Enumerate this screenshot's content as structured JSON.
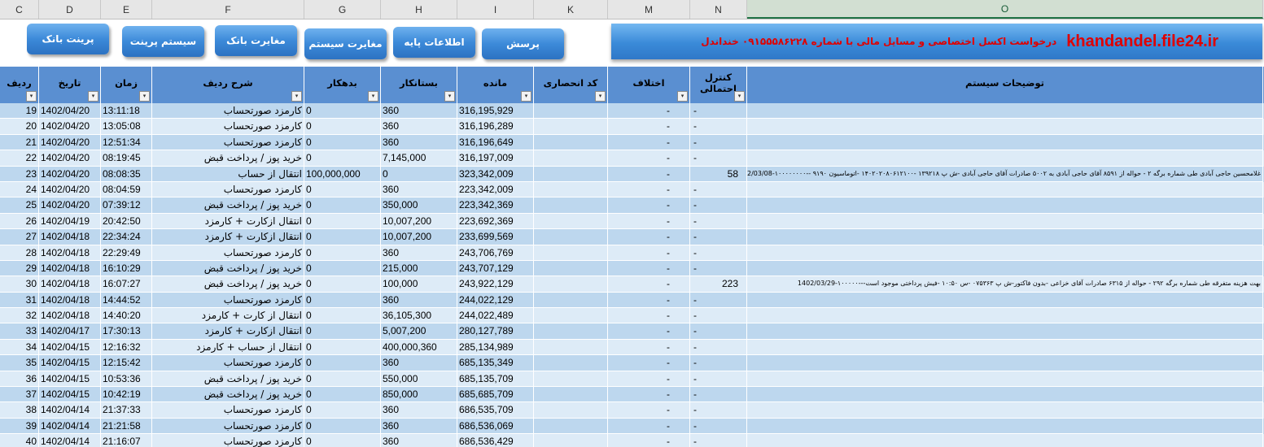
{
  "column_letters": [
    "C",
    "D",
    "E",
    "F",
    "G",
    "H",
    "I",
    "K",
    "M",
    "N",
    "O"
  ],
  "buttons": {
    "print_bank": "پرینت بانک",
    "system_print": "سیستم پرینت",
    "bank_mismatch": "مغایرت بانک",
    "system_mismatch": "مغایرت سیستم",
    "base_info": "اطلاعات پایه",
    "question": "پرسش"
  },
  "banner": {
    "site": "khandandel.file24.ir",
    "request": "درخواست اکسل اختصاصی و مسایل مالی با شماره ۰۹۱۵۵۵۸۶۲۲۸ خنداندل"
  },
  "headers": {
    "row_no": "ردیف",
    "date": "تاریخ",
    "time": "زمان",
    "row_desc": "شرح ردیف",
    "debit": "بدهکار",
    "credit": "بستانکار",
    "balance": "مانده",
    "exclusive_code": "کد انحصاری",
    "difference": "اختلاف",
    "probable_control_1": "کنترل",
    "probable_control_2": "احتمالی",
    "system_notes": "توضیحات سیستم"
  },
  "dropdown_glyph": "▾",
  "rows": [
    {
      "no": "19",
      "date": "1402/04/20",
      "time": "13:11:18",
      "desc": "کارمزد صورتحساب",
      "debit": "0",
      "credit": "360",
      "balance": "316,195,929",
      "code": "",
      "diff": "-",
      "ctrl": "-",
      "notes": ""
    },
    {
      "no": "20",
      "date": "1402/04/20",
      "time": "13:05:08",
      "desc": "کارمزد صورتحساب",
      "debit": "0",
      "credit": "360",
      "balance": "316,196,289",
      "code": "",
      "diff": "-",
      "ctrl": "-",
      "notes": ""
    },
    {
      "no": "21",
      "date": "1402/04/20",
      "time": "12:51:34",
      "desc": "کارمزد صورتحساب",
      "debit": "0",
      "credit": "360",
      "balance": "316,196,649",
      "code": "",
      "diff": "-",
      "ctrl": "-",
      "notes": ""
    },
    {
      "no": "22",
      "date": "1402/04/20",
      "time": "08:19:45",
      "desc": "خرید پوز / پرداخت قبض",
      "debit": "0",
      "credit": "7,145,000",
      "balance": "316,197,009",
      "code": "",
      "diff": "-",
      "ctrl": "-",
      "notes": ""
    },
    {
      "no": "23",
      "date": "1402/04/20",
      "time": "08:08:35",
      "desc": "انتقال از حساب",
      "debit": "100,000,000",
      "credit": "0",
      "balance": "323,342,009",
      "code": "",
      "diff": "-",
      "ctrl": "58",
      "notes": "غلامحسین حاجی آبادی طی شماره برگه ۲ - حواله از ۸۵۹۱ آقای حاجی آبادی به ۵۰۰۲ صادرات آقای حاجی آبادی -ش پ ۱۳۹۲۱۸ -۱۴۰۲۰۲۰۸۰۶۱۲۱۰۰ -اتوماسیون ۹۱۹۰ --۱۰۰۰۰۰۰۰۰-1402/03/08"
    },
    {
      "no": "24",
      "date": "1402/04/20",
      "time": "08:04:59",
      "desc": "کارمزد صورتحساب",
      "debit": "0",
      "credit": "360",
      "balance": "223,342,009",
      "code": "",
      "diff": "-",
      "ctrl": "-",
      "notes": ""
    },
    {
      "no": "25",
      "date": "1402/04/20",
      "time": "07:39:12",
      "desc": "خرید پوز / پرداخت قبض",
      "debit": "0",
      "credit": "350,000",
      "balance": "223,342,369",
      "code": "",
      "diff": "-",
      "ctrl": "-",
      "notes": ""
    },
    {
      "no": "26",
      "date": "1402/04/19",
      "time": "20:42:50",
      "desc": "انتقال ازکارت + کارمزد",
      "debit": "0",
      "credit": "10,007,200",
      "balance": "223,692,369",
      "code": "",
      "diff": "-",
      "ctrl": "-",
      "notes": ""
    },
    {
      "no": "27",
      "date": "1402/04/18",
      "time": "22:34:24",
      "desc": "انتقال ازکارت + کارمزد",
      "debit": "0",
      "credit": "10,007,200",
      "balance": "233,699,569",
      "code": "",
      "diff": "-",
      "ctrl": "-",
      "notes": ""
    },
    {
      "no": "28",
      "date": "1402/04/18",
      "time": "22:29:49",
      "desc": "کارمزد صورتحساب",
      "debit": "0",
      "credit": "360",
      "balance": "243,706,769",
      "code": "",
      "diff": "-",
      "ctrl": "-",
      "notes": ""
    },
    {
      "no": "29",
      "date": "1402/04/18",
      "time": "16:10:29",
      "desc": "خرید پوز / پرداخت قبض",
      "debit": "0",
      "credit": "215,000",
      "balance": "243,707,129",
      "code": "",
      "diff": "-",
      "ctrl": "-",
      "notes": ""
    },
    {
      "no": "30",
      "date": "1402/04/18",
      "time": "16:07:27",
      "desc": "خرید پوز / پرداخت قبض",
      "debit": "0",
      "credit": "100,000",
      "balance": "243,922,129",
      "code": "",
      "diff": "-",
      "ctrl": "223",
      "notes": "بهت هزینه متفرقه طی شماره برگه ۲۹۲ - حواله از ۶۳۱۵ صادرات آقای خزاعی -بدون فاکتور-ش پ ۰۷۵۳۶۳ -س ۱۰:۵۰ -فیش پرداختی موجود است---۱۰۰۰۰۰-1402/03/29"
    },
    {
      "no": "31",
      "date": "1402/04/18",
      "time": "14:44:52",
      "desc": "کارمزد صورتحساب",
      "debit": "0",
      "credit": "360",
      "balance": "244,022,129",
      "code": "",
      "diff": "-",
      "ctrl": "-",
      "notes": ""
    },
    {
      "no": "32",
      "date": "1402/04/18",
      "time": "14:40:20",
      "desc": "انتقال از کارت + کارمزد",
      "debit": "0",
      "credit": "36,105,300",
      "balance": "244,022,489",
      "code": "",
      "diff": "-",
      "ctrl": "-",
      "notes": ""
    },
    {
      "no": "33",
      "date": "1402/04/17",
      "time": "17:30:13",
      "desc": "انتقال ازکارت + کارمزد",
      "debit": "0",
      "credit": "5,007,200",
      "balance": "280,127,789",
      "code": "",
      "diff": "-",
      "ctrl": "-",
      "notes": ""
    },
    {
      "no": "34",
      "date": "1402/04/15",
      "time": "12:16:32",
      "desc": "انتقال از حساب + کارمزد",
      "debit": "0",
      "credit": "400,000,360",
      "balance": "285,134,989",
      "code": "",
      "diff": "-",
      "ctrl": "-",
      "notes": ""
    },
    {
      "no": "35",
      "date": "1402/04/15",
      "time": "12:15:42",
      "desc": "کارمزد صورتحساب",
      "debit": "0",
      "credit": "360",
      "balance": "685,135,349",
      "code": "",
      "diff": "-",
      "ctrl": "-",
      "notes": ""
    },
    {
      "no": "36",
      "date": "1402/04/15",
      "time": "10:53:36",
      "desc": "خرید پوز / پرداخت قبض",
      "debit": "0",
      "credit": "550,000",
      "balance": "685,135,709",
      "code": "",
      "diff": "-",
      "ctrl": "-",
      "notes": ""
    },
    {
      "no": "37",
      "date": "1402/04/15",
      "time": "10:42:19",
      "desc": "خرید پوز / پرداخت قبض",
      "debit": "0",
      "credit": "850,000",
      "balance": "685,685,709",
      "code": "",
      "diff": "-",
      "ctrl": "-",
      "notes": ""
    },
    {
      "no": "38",
      "date": "1402/04/14",
      "time": "21:37:33",
      "desc": "کارمزد صورتحساب",
      "debit": "0",
      "credit": "360",
      "balance": "686,535,709",
      "code": "",
      "diff": "-",
      "ctrl": "-",
      "notes": ""
    },
    {
      "no": "39",
      "date": "1402/04/14",
      "time": "21:21:58",
      "desc": "کارمزد صورتحساب",
      "debit": "0",
      "credit": "360",
      "balance": "686,536,069",
      "code": "",
      "diff": "-",
      "ctrl": "-",
      "notes": ""
    },
    {
      "no": "40",
      "date": "1402/04/14",
      "time": "21:16:07",
      "desc": "کارمزد صورتحساب",
      "debit": "0",
      "credit": "360",
      "balance": "686,536,429",
      "code": "",
      "diff": "-",
      "ctrl": "-",
      "notes": ""
    }
  ]
}
